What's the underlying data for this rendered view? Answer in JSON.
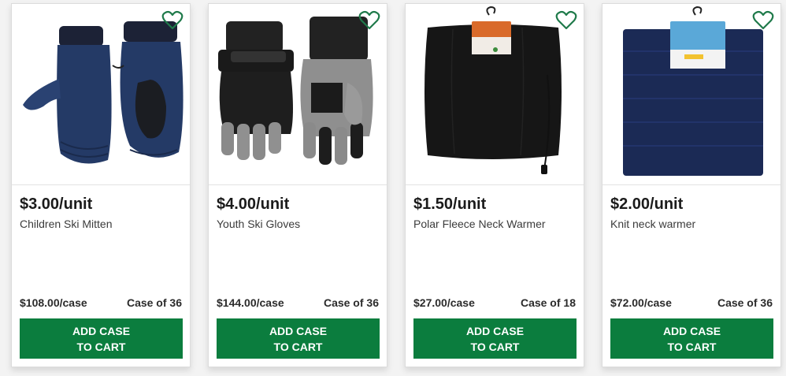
{
  "colors": {
    "accent": "#0b7d3e",
    "heart": "#1f7a4a"
  },
  "products": [
    {
      "price": "$3.00/unit",
      "name": "Children Ski Mitten",
      "case_price": "$108.00/case",
      "case_qty": "Case of 36",
      "btn_line1": "ADD CASE",
      "btn_line2": "TO CART",
      "image": "navy-mittens"
    },
    {
      "price": "$4.00/unit",
      "name": "Youth Ski Gloves",
      "case_price": "$144.00/case",
      "case_qty": "Case of 36",
      "btn_line1": "ADD CASE",
      "btn_line2": "TO CART",
      "image": "gray-black-gloves"
    },
    {
      "price": "$1.50/unit",
      "name": "Polar Fleece Neck Warmer",
      "case_price": "$27.00/case",
      "case_qty": "Case of 18",
      "btn_line1": "ADD CASE",
      "btn_line2": "TO CART",
      "image": "black-neck-warmer"
    },
    {
      "price": "$2.00/unit",
      "name": "Knit neck warmer",
      "case_price": "$72.00/case",
      "case_qty": "Case of 36",
      "btn_line1": "ADD CASE",
      "btn_line2": "TO CART",
      "image": "navy-knit-warmer"
    }
  ]
}
